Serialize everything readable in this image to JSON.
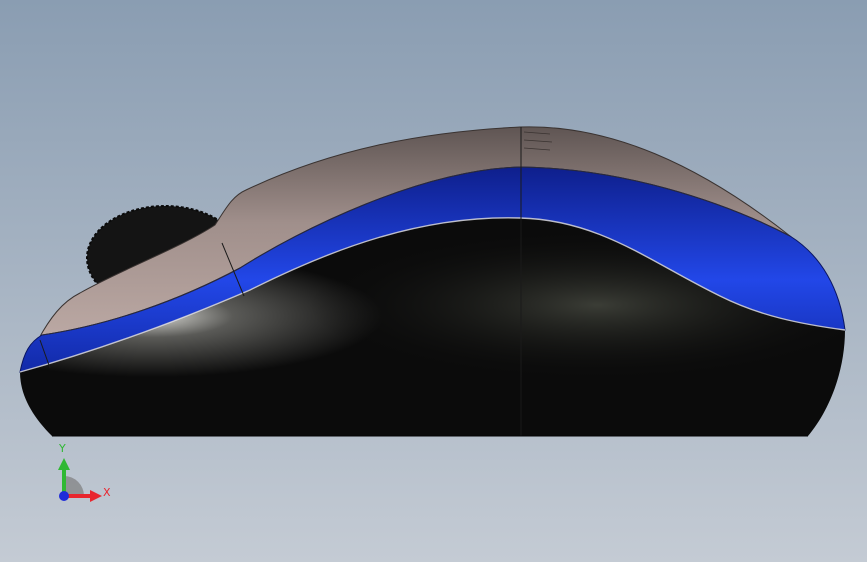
{
  "viewport": {
    "background_top": "#8a9db2",
    "background_bottom": "#c4cbd4"
  },
  "model": {
    "top_shell_color": "#8e7f7a",
    "accent_band_color": "#1f3fd6",
    "base_color": "#0b0b0b",
    "scroll_wheel_color": "#151515"
  },
  "triad": {
    "x_label": "X",
    "y_label": "Y",
    "x_color": "#e8262e",
    "y_color": "#2fb833",
    "z_color": "#1e2bd9"
  }
}
